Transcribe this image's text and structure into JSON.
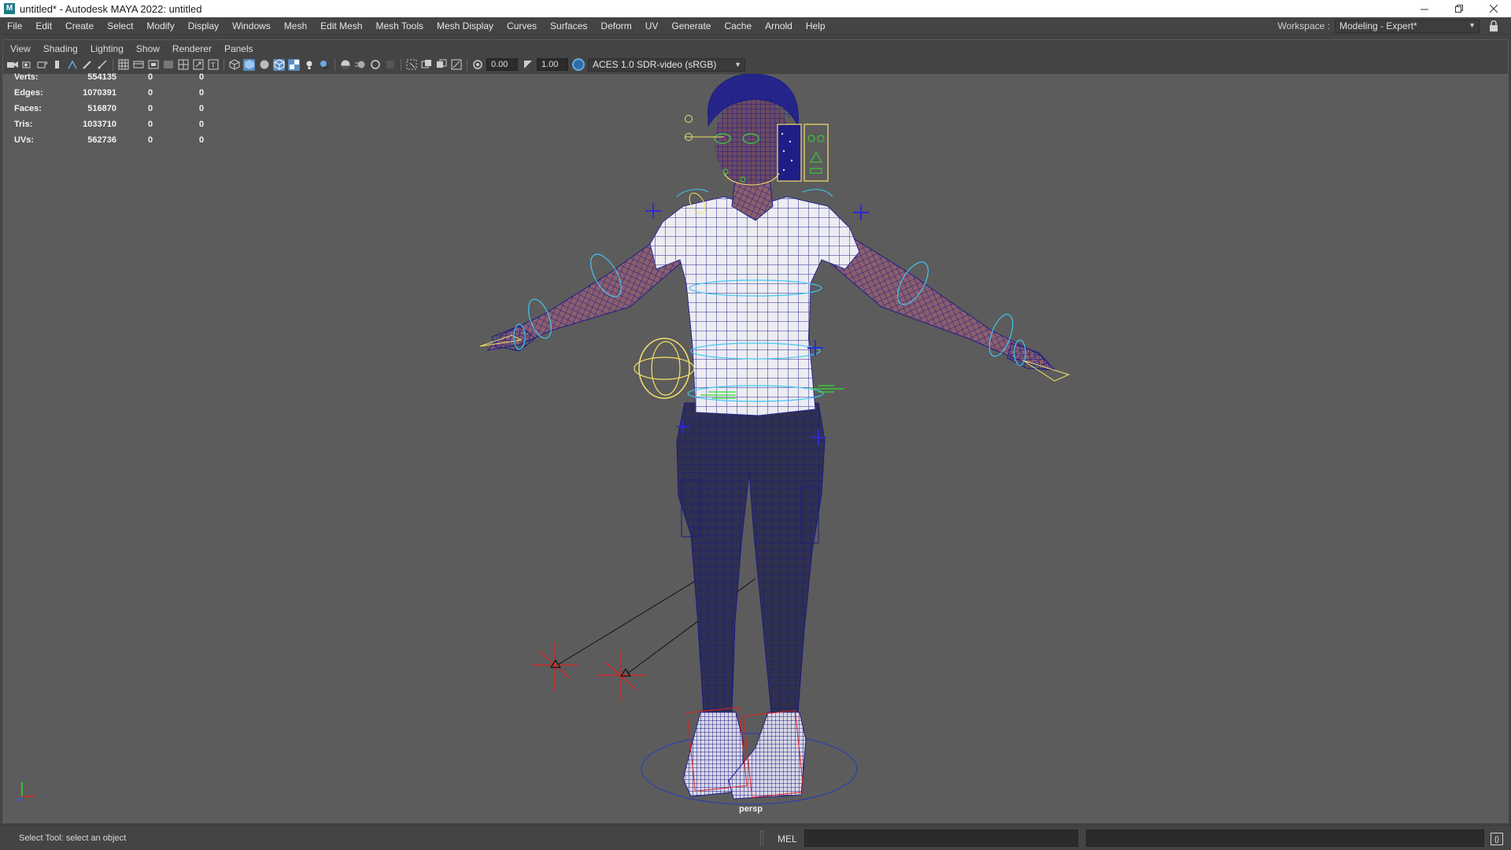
{
  "window": {
    "app_icon": "maya-logo",
    "title": "untitled* - Autodesk MAYA 2022: untitled",
    "buttons": [
      "minimize",
      "restore",
      "close"
    ]
  },
  "menubar": {
    "items": [
      "File",
      "Edit",
      "Create",
      "Select",
      "Modify",
      "Display",
      "Windows",
      "Mesh",
      "Edit Mesh",
      "Mesh Tools",
      "Mesh Display",
      "Curves",
      "Surfaces",
      "Deform",
      "UV",
      "Generate",
      "Cache",
      "Arnold",
      "Help"
    ],
    "workspace_label": "Workspace :",
    "workspace_value": "Modeling - Expert*"
  },
  "panel_menu": {
    "items": [
      "View",
      "Shading",
      "Lighting",
      "Show",
      "Renderer",
      "Panels"
    ]
  },
  "panel_toolbar": {
    "exposure": "0.00",
    "gamma": "1.00",
    "color_space": "ACES 1.0 SDR-video (sRGB)"
  },
  "hud": {
    "rows": [
      {
        "label": "Verts:",
        "total": "554135",
        "selected": "0",
        "third": "0"
      },
      {
        "label": "Edges:",
        "total": "1070391",
        "selected": "0",
        "third": "0"
      },
      {
        "label": "Faces:",
        "total": "516870",
        "selected": "0",
        "third": "0"
      },
      {
        "label": "Tris:",
        "total": "1033710",
        "selected": "0",
        "third": "0"
      },
      {
        "label": "UVs:",
        "total": "562736",
        "selected": "0",
        "third": "0"
      }
    ]
  },
  "viewport": {
    "camera": "persp"
  },
  "statusbar": {
    "help_line": "Select Tool: select an object",
    "command_language": "MEL"
  },
  "colors": {
    "viewport_bg": "#5c5c5c",
    "wire_blue": "#1f1e86",
    "rig_cyan": "#3ec8f0",
    "rig_yellow": "#f5e06a",
    "rig_green": "#33dd33",
    "locator_red": "#e02020",
    "accent_blue": "#5a8ec1"
  }
}
